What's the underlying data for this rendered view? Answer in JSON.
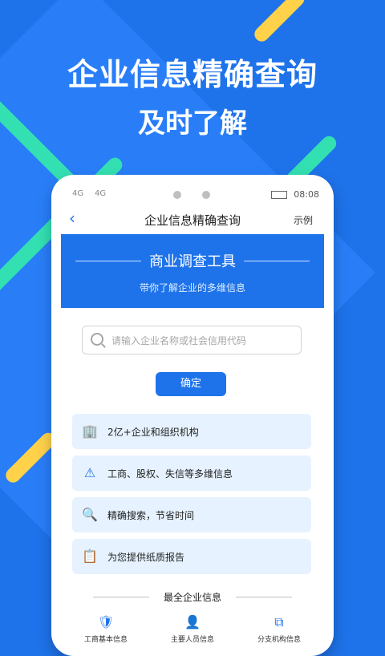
{
  "hero": {
    "title": "企业信息精确查询",
    "subtitle": "及时了解"
  },
  "phone": {
    "status": {
      "signal_left": "4G",
      "signal_right": "4G",
      "time": "08:08"
    },
    "nav": {
      "back_icon": "chevron-left-icon",
      "title": "企业信息精确查询",
      "right": "示例"
    },
    "banner": {
      "title": "商业调查工具",
      "subtitle": "带你了解企业的多维信息"
    },
    "search": {
      "placeholder": "请输入企业名称或社会信用代码"
    },
    "confirm_button": "确定",
    "features": [
      {
        "icon": "building-icon",
        "text": "2亿+企业和组织机构"
      },
      {
        "icon": "triangle-alert-icon",
        "text": "工商、股权、失信等多维信息"
      },
      {
        "icon": "magnifier-icon",
        "text": "精确搜索，节省时间"
      },
      {
        "icon": "clipboard-icon",
        "text": "为您提供纸质报告"
      }
    ],
    "section_title": "最全企业信息",
    "bottom": [
      {
        "icon": "badge-icon",
        "label": "工商基本信息"
      },
      {
        "icon": "person-card-icon",
        "label": "主要人员信息"
      },
      {
        "icon": "org-chart-icon",
        "label": "分支机构信息"
      }
    ]
  },
  "colors": {
    "brand": "#1e73ea",
    "accent_green": "#33e0b2",
    "accent_yellow": "#ffd24a"
  }
}
